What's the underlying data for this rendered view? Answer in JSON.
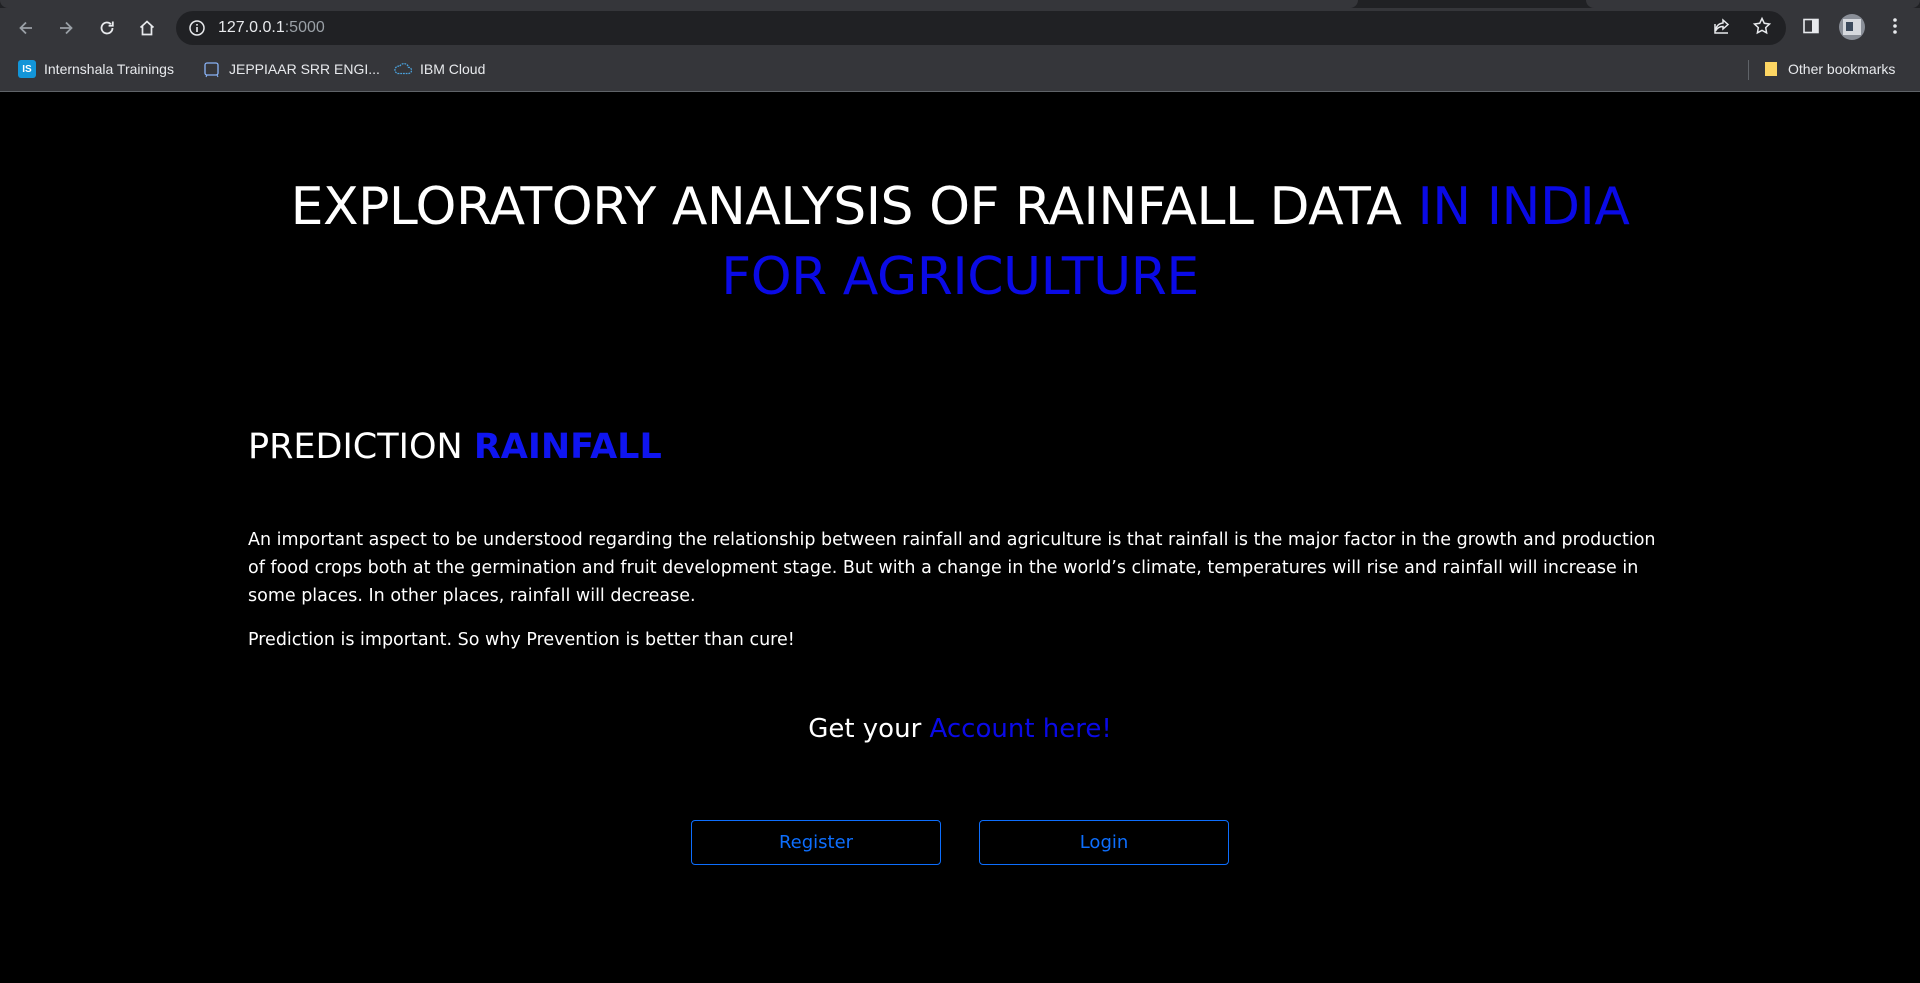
{
  "browser": {
    "url_host": "127.0.0.1",
    "url_port": ":5000",
    "bookmarks": [
      {
        "label": "Internshala Trainings",
        "icon": "internshala-icon"
      },
      {
        "label": "JEPPIAAR SRR ENGI...",
        "icon": "page-icon"
      },
      {
        "label": "IBM Cloud",
        "icon": "ibm-cloud-icon"
      }
    ],
    "other_bookmarks": "Other bookmarks",
    "internshala_badge": "IS"
  },
  "hero": {
    "title_white": "EXPLORATORY ANALYSIS OF RAINFALL DATA",
    "title_blue_1": "IN INDIA",
    "title_blue_2": "FOR AGRICULTURE"
  },
  "section": {
    "title_prefix": "PREDICTION",
    "title_accent": "RAINFALL",
    "paragraph": "An important aspect to be understood regarding the relationship between rainfall and agriculture is that rainfall is the major factor in the growth and production of food crops both at the germination and fruit development stage. But with a change in the world’s climate, temperatures will rise and rainfall will increase in some places. In other places, rainfall will decrease.",
    "note": "Prediction is important. So why Prevention is better than cure!"
  },
  "cta": {
    "prefix": "Get your",
    "link": "Account here!"
  },
  "buttons": {
    "register": "Register",
    "login": "Login"
  },
  "colors": {
    "accent_blue": "#0a0ae6",
    "button_blue": "#0d6efd",
    "background": "#000000"
  }
}
